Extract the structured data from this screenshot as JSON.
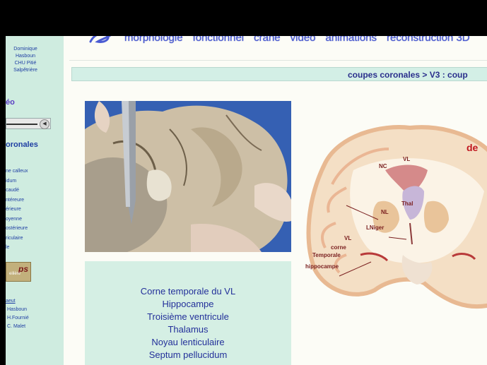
{
  "sidebar": {
    "author_lines": [
      "Dominique",
      "Hasboun",
      "CHU Pitié",
      "Salpêtrière"
    ],
    "sound_label": "éo",
    "section_title": "oronales",
    "menu_items": [
      "ne calleux",
      "idum",
      "caudé",
      "ntéreure",
      "érieure",
      "oyenne",
      "ostérieure",
      "riculaire",
      "le"
    ],
    "logo_text": "ps",
    "logo_sub": "eilière",
    "credits_heading": "aeut",
    "credits": [
      "Hasboun",
      "H.Fournié",
      "C. Malet"
    ]
  },
  "nav": {
    "items": [
      "morphologie",
      "fonctionnel",
      "crâne",
      "video",
      "animations",
      "reconstruction 3D"
    ]
  },
  "breadcrumb": "coupes coronales > V3 : coup",
  "caption": {
    "items": [
      "Corne temporale du VL",
      "Hippocampe",
      "Troisième ventricule",
      "Thalamus",
      "Noyau lenticulaire",
      "Septum pellucidum"
    ]
  },
  "diagram": {
    "corner_label": "de",
    "labels": {
      "nc": "NC",
      "vl_top": "VL",
      "thal": "Thal",
      "nl": "NL",
      "lniger": "LNiger",
      "vl": "VL",
      "corne": "corne",
      "temporale": "Temporale",
      "hippocampe": "hippocampe"
    }
  },
  "colors": {
    "sidebar_bg": "#cfece0",
    "link_blue": "#1f3fa3",
    "nav_blue": "#4a5bd3",
    "label_red": "#7a1f1f"
  }
}
